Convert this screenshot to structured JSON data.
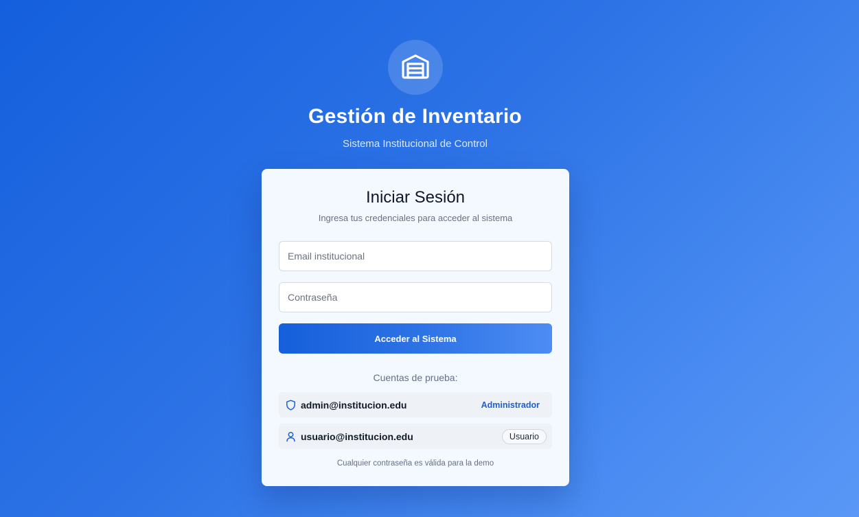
{
  "header": {
    "logo_icon": "warehouse-icon",
    "title": "Gestión de Inventario",
    "subtitle": "Sistema Institucional de Control"
  },
  "login": {
    "title": "Iniciar Sesión",
    "subtitle": "Ingresa tus credenciales para acceder al sistema",
    "email_placeholder": "Email institucional",
    "email_value": "",
    "password_placeholder": "Contraseña",
    "password_value": "",
    "submit_label": "Acceder al Sistema"
  },
  "test_accounts": {
    "heading": "Cuentas de prueba:",
    "accounts": [
      {
        "icon": "shield-icon",
        "email": "admin@institucion.edu",
        "role": "Administrador"
      },
      {
        "icon": "user-icon",
        "email": "usuario@institucion.edu",
        "role": "Usuario"
      }
    ],
    "note": "Cualquier contraseña es válida para la demo"
  },
  "colors": {
    "background_start": "#145fdd",
    "background_end": "#5a97f6",
    "accent": "#1d5fcf",
    "card": "#f4f8ff"
  }
}
